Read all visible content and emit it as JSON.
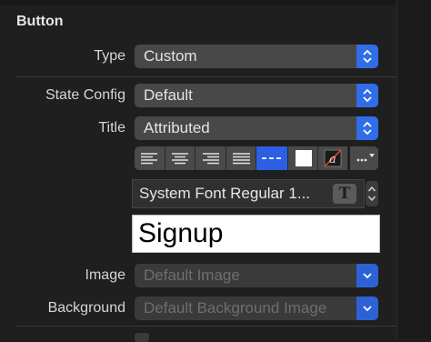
{
  "section": {
    "title": "Button"
  },
  "rows": {
    "type": {
      "label": "Type",
      "value": "Custom"
    },
    "state_config": {
      "label": "State Config",
      "value": "Default"
    },
    "title": {
      "label": "Title",
      "value": "Attributed"
    },
    "image": {
      "label": "Image",
      "placeholder": "Default Image"
    },
    "background": {
      "label": "Background",
      "placeholder": "Default Background Image"
    }
  },
  "text_toolbar": {
    "items": [
      "align-left-icon",
      "align-center-icon",
      "align-right-icon",
      "justify-icon",
      "dashed-line-icon",
      "text-color-swatch",
      "highlight-color-swatch",
      "more-options-icon"
    ],
    "selected": "dashed-line-icon",
    "more_label": "..."
  },
  "font": {
    "value": "System Font Regular 1...",
    "button_glyph": "T"
  },
  "title_text": {
    "value": "Signup"
  },
  "colors": {
    "background": "#1f1f1f",
    "popup": "#484848",
    "accent": "#2f6ee8",
    "label": "#d6d6d6",
    "disabled_text": "#6e6e6e"
  }
}
